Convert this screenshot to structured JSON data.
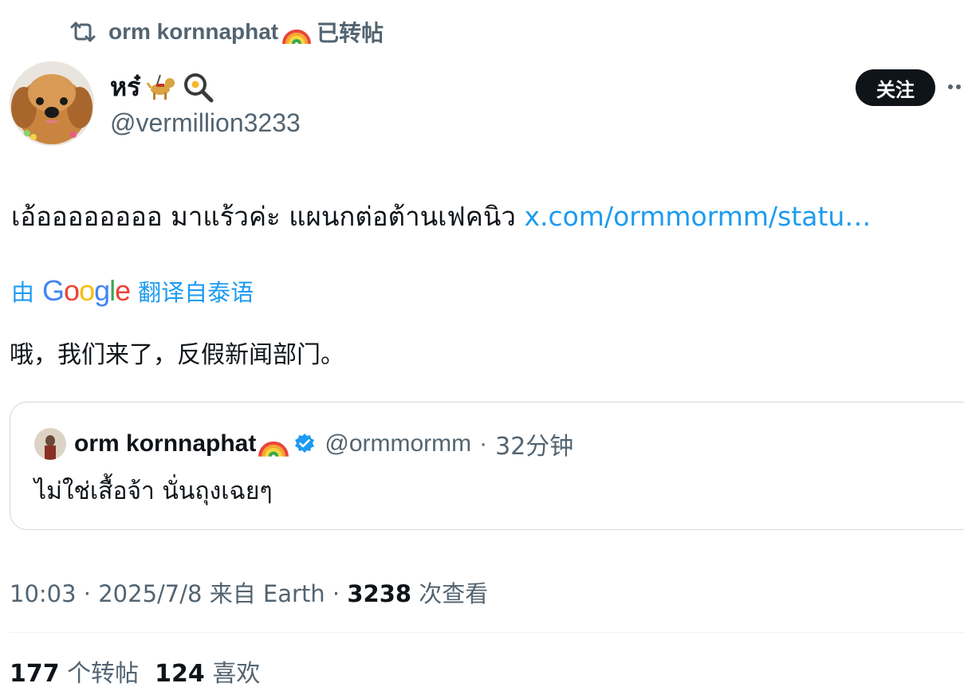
{
  "repost_header": {
    "name": "orm kornnaphat",
    "suffix": "已转帖"
  },
  "author": {
    "display_name": "หร๋",
    "handle": "@vermillion3233"
  },
  "follow_button": {
    "label": "关注"
  },
  "tweet": {
    "text": "เอ้ออออออออ มาแร้วค่ะ แผนกต่อต้านเฟคนิว ",
    "link": "x.com/ormmormm/statu…"
  },
  "translation": {
    "prefix": "由",
    "provider": "Google",
    "suffix": "翻译自泰语",
    "text": "哦，我们来了，反假新闻部门。"
  },
  "quote": {
    "name": "orm kornnaphat",
    "handle": "@ormmormm",
    "separator": "·",
    "time": "32分钟",
    "text": "ไม่ใช่เสื้อจ้า นั่นถุงเฉยๆ"
  },
  "meta": {
    "time": "10:03",
    "dot1": "·",
    "date": "2025/7/8",
    "source": "来自 Earth",
    "dot2": "·",
    "views_count": "3238",
    "views_label": "次查看"
  },
  "stats": {
    "reposts_count": "177",
    "reposts_label": "个转帖",
    "likes_count": "124",
    "likes_label": "喜欢"
  },
  "colors": {
    "link": "#1d9bf0",
    "secondary_text": "#536471",
    "primary_text": "#0f1419",
    "border": "#cfd9de"
  },
  "icons": [
    "repost-icon",
    "rainbow-icon",
    "guide-dog-icon",
    "frying-pan-icon",
    "more-icon",
    "verified-badge-icon"
  ]
}
